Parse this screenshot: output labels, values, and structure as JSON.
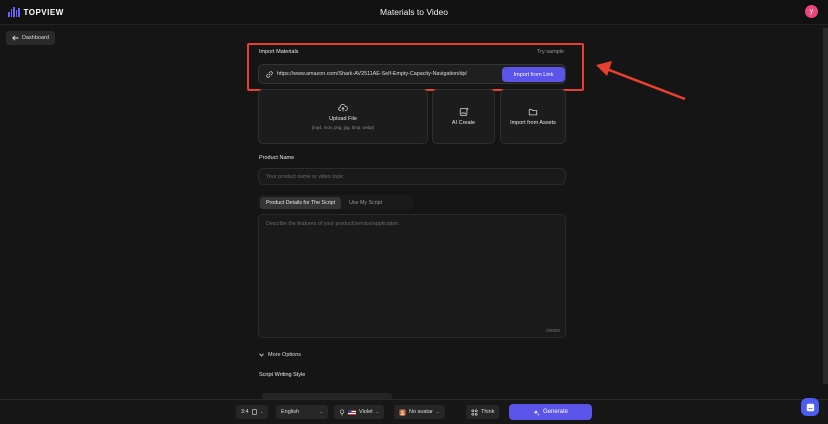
{
  "header": {
    "brand": "TOPVIEW",
    "title": "Materials to Video",
    "avatar_initial": "y"
  },
  "nav": {
    "back_label": "Dashboard"
  },
  "import": {
    "label": "Import Materials",
    "try_sample": "Try sample",
    "url_value": "https://www.amazon.com/Shark-AV2511AE-Self-Empty-Capacity-Navigation/dp/",
    "button_label": "Import from Link"
  },
  "upload_cards": {
    "upload": {
      "title": "Upload File",
      "formats": "(mp4, mov, png, jpg, bmp, webp)"
    },
    "ai_create": {
      "title": "AI Create"
    },
    "assets": {
      "title": "Import from Assets"
    }
  },
  "product": {
    "label": "Product Name",
    "placeholder": "Your product name or video topic"
  },
  "script_tabs": [
    {
      "label": "Product Details for The Script",
      "active": true
    },
    {
      "label": "Use My Script",
      "active": false
    }
  ],
  "description": {
    "placeholder": "Describe the features of your product/service/application.",
    "counter": "0/5000"
  },
  "more_options": "More Options",
  "script_style_label": "Script Writing Style",
  "bottom_bar": {
    "ratio": "3:4",
    "language": "English",
    "voice": "Violet",
    "avatar": "No avatar",
    "think": "Think",
    "generate": "Generate"
  },
  "colors": {
    "accent": "#5b54e8",
    "highlight": "#e8402f",
    "avatar_bg": "#e8457a"
  }
}
